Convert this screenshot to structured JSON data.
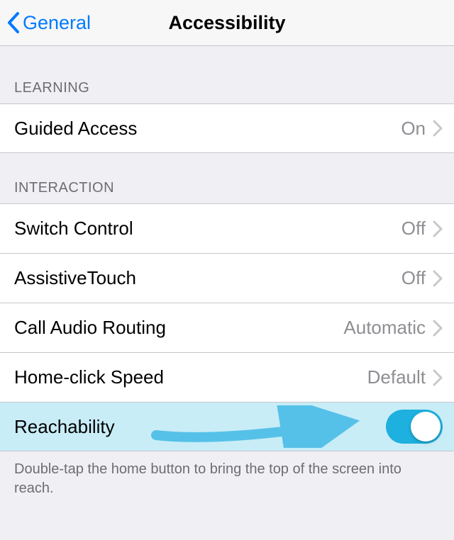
{
  "nav": {
    "back_label": "General",
    "title": "Accessibility"
  },
  "sections": {
    "learning": {
      "header": "LEARNING",
      "guided_access": {
        "label": "Guided Access",
        "value": "On"
      }
    },
    "interaction": {
      "header": "INTERACTION",
      "switch_control": {
        "label": "Switch Control",
        "value": "Off"
      },
      "assistivetouch": {
        "label": "AssistiveTouch",
        "value": "Off"
      },
      "call_audio_routing": {
        "label": "Call Audio Routing",
        "value": "Automatic"
      },
      "home_click_speed": {
        "label": "Home-click Speed",
        "value": "Default"
      },
      "reachability": {
        "label": "Reachability",
        "toggled": true
      }
    }
  },
  "footer": "Double-tap the home button to bring the top of the screen into reach.",
  "colors": {
    "ios_blue": "#007aff",
    "highlight_bg": "#c8edf7",
    "toggle_on": "#1eb0de",
    "arrow": "#56c1e8"
  }
}
